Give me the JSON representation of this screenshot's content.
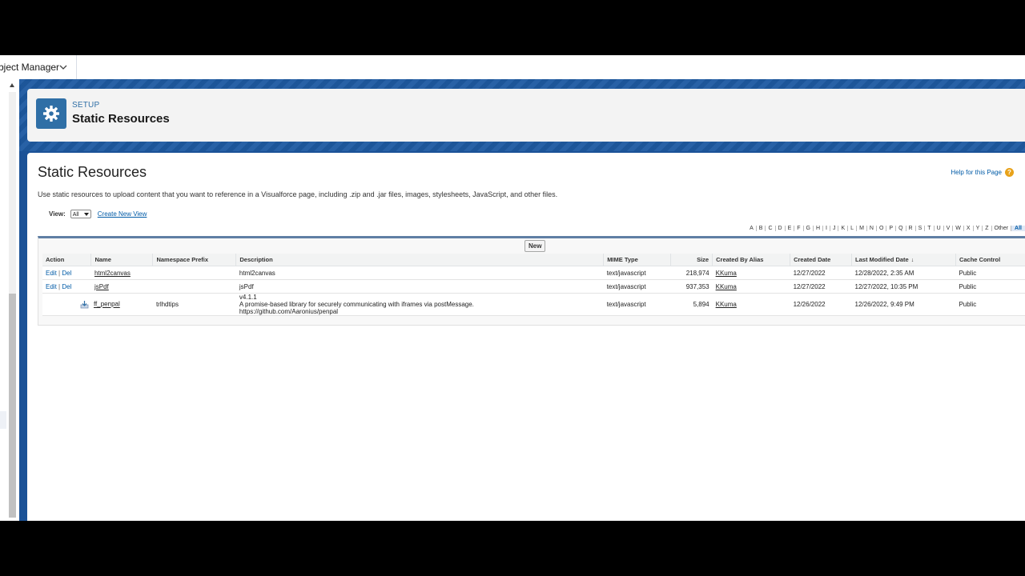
{
  "tab": {
    "label": "bject Manager"
  },
  "header": {
    "setup_label": "SETUP",
    "title": "Static Resources"
  },
  "page": {
    "title": "Static Resources",
    "help_label": "Help for this Page",
    "description": "Use static resources to upload content that you want to reference in a Visualforce page, including .zip and .jar files, images, stylesheets, JavaScript, and other files."
  },
  "view": {
    "label": "View:",
    "selected": "All",
    "create_new_view": "Create New View"
  },
  "alphabet": [
    "A",
    "B",
    "C",
    "D",
    "E",
    "F",
    "G",
    "H",
    "I",
    "J",
    "K",
    "L",
    "M",
    "N",
    "O",
    "P",
    "Q",
    "R",
    "S",
    "T",
    "U",
    "V",
    "W",
    "X",
    "Y",
    "Z",
    "Other",
    "All"
  ],
  "buttons": {
    "new": "New"
  },
  "table": {
    "columns": {
      "action": "Action",
      "name": "Name",
      "namespace": "Namespace Prefix",
      "description": "Description",
      "mime": "MIME Type",
      "size": "Size",
      "created_by": "Created By Alias",
      "created_date": "Created Date",
      "last_modified": "Last Modified Date",
      "cache_control": "Cache Control"
    },
    "action_edit": "Edit",
    "action_separator": "|",
    "action_del": "Del",
    "rows": [
      {
        "name": "html2canvas",
        "namespace": "",
        "description": "html2canvas",
        "mime": "text/javascript",
        "size": "218,974",
        "created_by": "KKuma",
        "created_date": "12/27/2022",
        "last_modified": "12/28/2022, 2:35 AM",
        "cache_control": "Public"
      },
      {
        "name": "jsPdf",
        "namespace": "",
        "description": "jsPdf",
        "mime": "text/javascript",
        "size": "937,353",
        "created_by": "KKuma",
        "created_date": "12/27/2022",
        "last_modified": "12/27/2022, 10:35 PM",
        "cache_control": "Public"
      },
      {
        "name": "ff_penpal",
        "namespace": "trlhdtips",
        "description_lines": [
          "v4.1.1",
          "A promise-based library for securely communicating with iframes via postMessage.",
          "https://github.com/Aaronius/penpal"
        ],
        "mime": "text/javascript",
        "size": "5,894",
        "created_by": "KKuma",
        "created_date": "12/26/2022",
        "last_modified": "12/26/2022, 9:49 PM",
        "cache_control": "Public"
      }
    ]
  },
  "icons": {
    "tab_chevron": "chevron-down-icon",
    "header": "gear-icon",
    "help": "help-icon",
    "download": "download-icon",
    "sort": "sort-desc-icon"
  },
  "colors": {
    "band": "#1b5297",
    "header_icon": "#2f6fa6",
    "link": "#015ba7",
    "list_border": "#5f7fa4",
    "help_icon": "#e8a21a"
  }
}
